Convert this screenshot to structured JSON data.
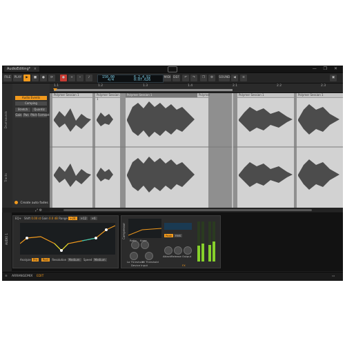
{
  "window": {
    "tab_title": "AudioEditing*",
    "close_glyph": "×",
    "controls": "— ❐ ✕"
  },
  "toolbar": {
    "file_label": "FILE",
    "play_label": "PLAY",
    "tempo": "150.00",
    "signature": "4/4",
    "position": "6.2.4.92",
    "time": "0:07.626",
    "mode_labels": [
      "MIDI",
      "DEF"
    ],
    "sound_label": "SOUND"
  },
  "ruler": {
    "ticks": [
      "1.1",
      "1.2",
      "1.3",
      "1.4",
      "2.1",
      "2.2",
      "2.3"
    ]
  },
  "inspector": {
    "track_name": "Drumsounds",
    "track_label": "Tracks"
  },
  "panel": {
    "audio_events": "Audio Events",
    "comping": "Comping",
    "stretch": "Stretch",
    "quantize": "Quantiz",
    "buttons": [
      "Gain",
      "Pan",
      "Pitch",
      "Formant"
    ],
    "auto_fades": "Create auto fades"
  },
  "clips": [
    {
      "label": "Polymer Session 1"
    },
    {
      "label": "Polymer Session 1"
    },
    {
      "label": "Polymer Session 1"
    },
    {
      "label": "Polymer"
    },
    {
      "label": "Polymer Session 1"
    },
    {
      "label": "Polymer Session 1"
    }
  ],
  "device_chain": {
    "track_label": "AUDIO 1",
    "eq": {
      "title": "EQ+",
      "shift": "Shift",
      "shift_val": "0.00 st",
      "gain": "Gain",
      "gain_val": "0.0 dB",
      "range": "Range",
      "range_opts": [
        "+24",
        "+12",
        "+6"
      ],
      "analyzer": "Analyze",
      "pre": "Pre",
      "post": "Post",
      "resolution": "Resolution",
      "res_val": "Medium",
      "speed": "Speed",
      "speed_val": "Medium"
    },
    "comp": {
      "title": "Compressor",
      "peak": "Peak",
      "rms": "RMS",
      "knobs": [
        "Ratio",
        "Knee",
        "Attack",
        "Release",
        "Output"
      ],
      "thresholds": [
        "Lo Threshold",
        "Hi Threshold"
      ],
      "device_input": "Device Input",
      "fx": "FX"
    }
  },
  "statusbar": {
    "items": [
      "ARRANGE",
      "MIX",
      "EDIT"
    ]
  },
  "colors": {
    "accent": "#f29a1d",
    "meter": "#86d12b",
    "eq_curve": "#f29a1d"
  }
}
